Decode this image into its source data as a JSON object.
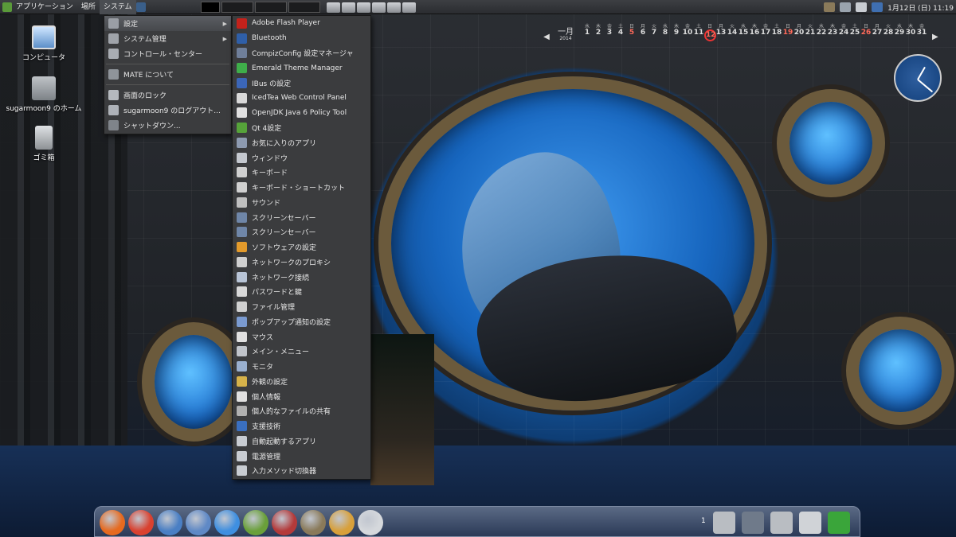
{
  "top_panel": {
    "applications": "アプリケーション",
    "places": "場所",
    "system": "システム",
    "clock": "1月12日 (日) 11:19"
  },
  "desktop": {
    "icons": [
      {
        "label": "コンピュータ",
        "icon": "computer-icon"
      },
      {
        "label": "sugarmoon9 のホーム",
        "icon": "home-folder-icon"
      },
      {
        "label": "ゴミ箱",
        "icon": "trash-icon"
      }
    ]
  },
  "calendar": {
    "month": "一月",
    "year": "2014",
    "weekdays": [
      "水",
      "木",
      "金",
      "土",
      "日",
      "月",
      "火",
      "水",
      "木",
      "金",
      "土",
      "日",
      "月",
      "火",
      "水",
      "木",
      "金",
      "土",
      "日",
      "月",
      "火",
      "水",
      "木",
      "金",
      "土",
      "日",
      "月",
      "火",
      "水",
      "木",
      "金"
    ],
    "days": [
      "1",
      "2",
      "3",
      "4",
      "5",
      "6",
      "7",
      "8",
      "9",
      "10",
      "11",
      "12",
      "13",
      "14",
      "15",
      "16",
      "17",
      "18",
      "19",
      "20",
      "21",
      "22",
      "23",
      "24",
      "25",
      "26",
      "27",
      "28",
      "29",
      "30",
      "31"
    ],
    "today": "12"
  },
  "system_menu": {
    "items": [
      {
        "label": "設定",
        "icon": "settings-icon",
        "submenu": true,
        "selected": true
      },
      {
        "label": "システム管理",
        "icon": "admin-icon",
        "submenu": true
      },
      {
        "label": "コントロール・センター",
        "icon": "control-center-icon"
      },
      {
        "label": "MATE について",
        "icon": "about-icon",
        "sep_before": true
      },
      {
        "label": "画面のロック",
        "icon": "lock-screen-icon",
        "sep_before": true
      },
      {
        "label": "sugarmoon9 のログアウト...",
        "icon": "logout-icon"
      },
      {
        "label": "シャットダウン...",
        "icon": "shutdown-icon"
      }
    ]
  },
  "settings_menu": {
    "items": [
      {
        "label": "Adobe Flash Player",
        "icon": "flash-icon",
        "color": "#c4221b"
      },
      {
        "label": "Bluetooth",
        "icon": "bluetooth-icon",
        "color": "#2f5fa8"
      },
      {
        "label": "CompizConfig 設定マネージャ",
        "icon": "compiz-icon",
        "color": "#6f7f9a"
      },
      {
        "label": "Emerald Theme Manager",
        "icon": "emerald-icon",
        "color": "#3fae4a"
      },
      {
        "label": "IBus の設定",
        "icon": "ibus-icon",
        "color": "#3b66b8"
      },
      {
        "label": "IcedTea Web Control Panel",
        "icon": "icedtea-icon",
        "color": "#d8d8d8"
      },
      {
        "label": "OpenJDK Java 6 Policy Tool",
        "icon": "java-icon",
        "color": "#e0e0e0"
      },
      {
        "label": "Qt 4設定",
        "icon": "qt-icon",
        "color": "#56a33a"
      },
      {
        "label": "お気に入りのアプリ",
        "icon": "favorite-apps-icon",
        "color": "#8d9ab0"
      },
      {
        "label": "ウィンドウ",
        "icon": "window-icon",
        "color": "#c4c8cf"
      },
      {
        "label": "キーボード",
        "icon": "keyboard-icon",
        "color": "#d0d0d0"
      },
      {
        "label": "キーボード・ショートカット",
        "icon": "keyboard-shortcut-icon",
        "color": "#d0d0d0"
      },
      {
        "label": "サウンド",
        "icon": "sound-icon",
        "color": "#bfbfbf"
      },
      {
        "label": "スクリーンセーバー",
        "icon": "screensaver-icon",
        "color": "#6f86a8"
      },
      {
        "label": "スクリーンセーバー",
        "icon": "screensaver-icon",
        "color": "#6f86a8"
      },
      {
        "label": "ソフトウェアの設定",
        "icon": "software-icon",
        "color": "#e39a2b"
      },
      {
        "label": "ネットワークのプロキシ",
        "icon": "proxy-icon",
        "color": "#cfcfcf"
      },
      {
        "label": "ネットワーク接続",
        "icon": "network-icon",
        "color": "#b8c4d6"
      },
      {
        "label": "パスワードと鍵",
        "icon": "keys-icon",
        "color": "#d8d8d8"
      },
      {
        "label": "ファイル管理",
        "icon": "file-management-icon",
        "color": "#d0d0d0"
      },
      {
        "label": "ポップアップ通知の設定",
        "icon": "notification-icon",
        "color": "#7a9ad0"
      },
      {
        "label": "マウス",
        "icon": "mouse-icon",
        "color": "#e0e0e0"
      },
      {
        "label": "メイン・メニュー",
        "icon": "main-menu-icon",
        "color": "#c0c4ca"
      },
      {
        "label": "モニタ",
        "icon": "monitor-icon",
        "color": "#9ab0cf"
      },
      {
        "label": "外観の設定",
        "icon": "appearance-icon",
        "color": "#d6b24a"
      },
      {
        "label": "個人情報",
        "icon": "personal-info-icon",
        "color": "#e0e0e0"
      },
      {
        "label": "個人的なファイルの共有",
        "icon": "file-share-icon",
        "color": "#b0b0b0"
      },
      {
        "label": "支援技術",
        "icon": "accessibility-icon",
        "color": "#3a6fc0"
      },
      {
        "label": "自動起動するアプリ",
        "icon": "startup-apps-icon",
        "color": "#c8ccd2"
      },
      {
        "label": "電源管理",
        "icon": "power-icon",
        "color": "#c8ccd2"
      },
      {
        "label": "入力メソッド切換器",
        "icon": "input-method-icon",
        "color": "#c8ccd2"
      }
    ]
  },
  "dock": {
    "workspace_number": "1",
    "apps": [
      {
        "name": "firefox-icon",
        "color": "#e66a1f"
      },
      {
        "name": "chrome-icon",
        "color": "#d9412f"
      },
      {
        "name": "thunderbird-icon",
        "color": "#4a7fc4"
      },
      {
        "name": "dragon-icon",
        "color": "#5f89c6"
      },
      {
        "name": "dropbox-icon",
        "color": "#3f8fe0"
      },
      {
        "name": "owl-icon",
        "color": "#6aa03a"
      },
      {
        "name": "package-icon",
        "color": "#b43a3a"
      },
      {
        "name": "gimp-icon",
        "color": "#8a7a5a"
      },
      {
        "name": "fox-cat-icon",
        "color": "#d8a03a"
      },
      {
        "name": "gear-icon",
        "color": "#d5d8dc"
      }
    ],
    "right_items": [
      {
        "name": "folder-camera-icon",
        "color": "#b9bdc2"
      },
      {
        "name": "screen-icon",
        "color": "#6f7a8a"
      },
      {
        "name": "home-folder-dock-icon",
        "color": "#b9bdc2"
      },
      {
        "name": "speaker-icon",
        "color": "#d0d3d7"
      },
      {
        "name": "exit-icon",
        "color": "#3aa53a"
      }
    ]
  }
}
